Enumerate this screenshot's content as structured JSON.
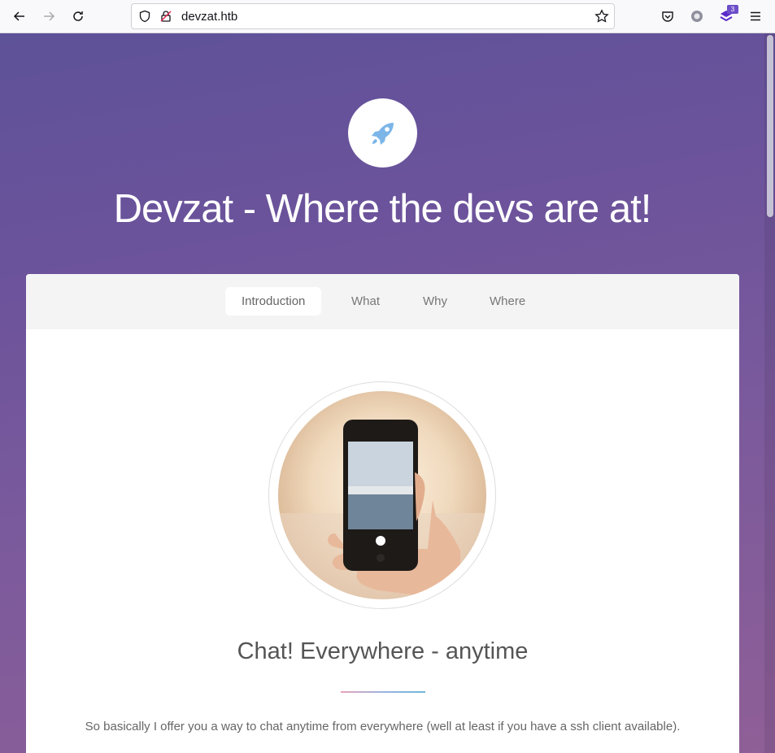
{
  "browser": {
    "url": "devzat.htb",
    "extension_badge_count": "3"
  },
  "hero": {
    "title": "Devzat - Where the devs are at!",
    "logo_icon": "rocket-icon"
  },
  "tabs": [
    {
      "label": "Introduction",
      "active": true
    },
    {
      "label": "What",
      "active": false
    },
    {
      "label": "Why",
      "active": false
    },
    {
      "label": "Where",
      "active": false
    }
  ],
  "intro": {
    "heading": "Chat! Everywhere - anytime",
    "text": "So basically I offer you a way to chat anytime from everywhere (well at least if you have a ssh client available)."
  },
  "colors": {
    "accent_rocket": "#7cb6e8",
    "gradient_top": "#5e5299",
    "gradient_bottom": "#8f5f97"
  }
}
